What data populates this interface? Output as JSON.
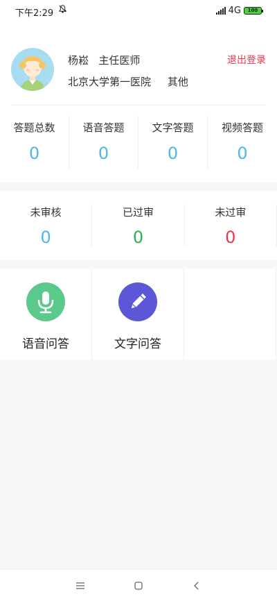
{
  "status_bar": {
    "time": "下午2:29",
    "network": "4G",
    "battery": "100"
  },
  "profile": {
    "name": "杨崧",
    "title": "主任医师",
    "hospital": "北京大学第一医院",
    "department": "其他",
    "logout_label": "退出登录"
  },
  "answer_stats": [
    {
      "label": "答题总数",
      "value": "0"
    },
    {
      "label": "语音答题",
      "value": "0"
    },
    {
      "label": "文字答题",
      "value": "0"
    },
    {
      "label": "视频答题",
      "value": "0"
    }
  ],
  "review_stats": [
    {
      "label": "未审核",
      "value": "0",
      "color": "#4ab8e8"
    },
    {
      "label": "已过审",
      "value": "0",
      "color": "#2bb24c"
    },
    {
      "label": "未过审",
      "value": "0",
      "color": "#e8394c"
    }
  ],
  "actions": [
    {
      "label": "语音问答",
      "icon": "microphone-icon",
      "color": "#5cc98c"
    },
    {
      "label": "文字问答",
      "icon": "pencil-icon",
      "color": "#5b57d6"
    }
  ],
  "colors": {
    "accent_blue": "#4ab8e8",
    "logout_red": "#e8394c"
  }
}
